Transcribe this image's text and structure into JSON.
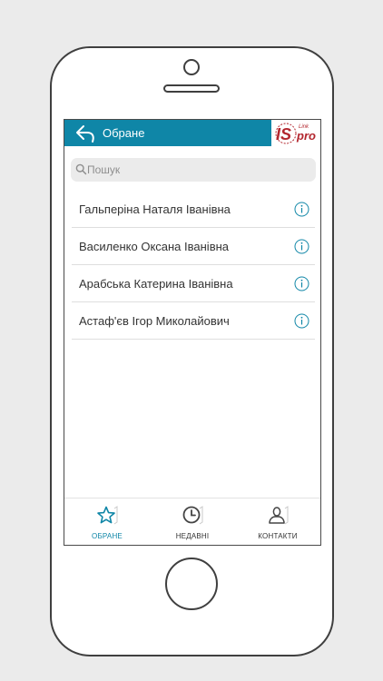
{
  "navbar": {
    "title": "Обране",
    "back_icon": "back-arrow-icon",
    "logo_text_main": "IS",
    "logo_text_pro": "pro",
    "logo_text_link": "Link"
  },
  "search": {
    "placeholder": "Пошук",
    "value": ""
  },
  "contacts": [
    {
      "name": "Гальперіна Наталя Іванівна",
      "icon": "info-icon"
    },
    {
      "name": "Василенко Оксана Іванівна",
      "icon": "info-icon"
    },
    {
      "name": "Арабська Катерина Іванівна",
      "icon": "info-icon"
    },
    {
      "name": "Астаф'єв Ігор Миколайович",
      "icon": "info-icon"
    }
  ],
  "tabs": [
    {
      "label": "ОБРАНЕ",
      "icon": "star-icon",
      "active": true
    },
    {
      "label": "НЕДАВНІ",
      "icon": "clock-icon",
      "active": false
    },
    {
      "label": "КОНТАКТИ",
      "icon": "person-icon",
      "active": false
    }
  ],
  "colors": {
    "accent": "#0f86a7",
    "logo_red": "#b3262e",
    "text": "#333333",
    "separator": "#dedede"
  }
}
